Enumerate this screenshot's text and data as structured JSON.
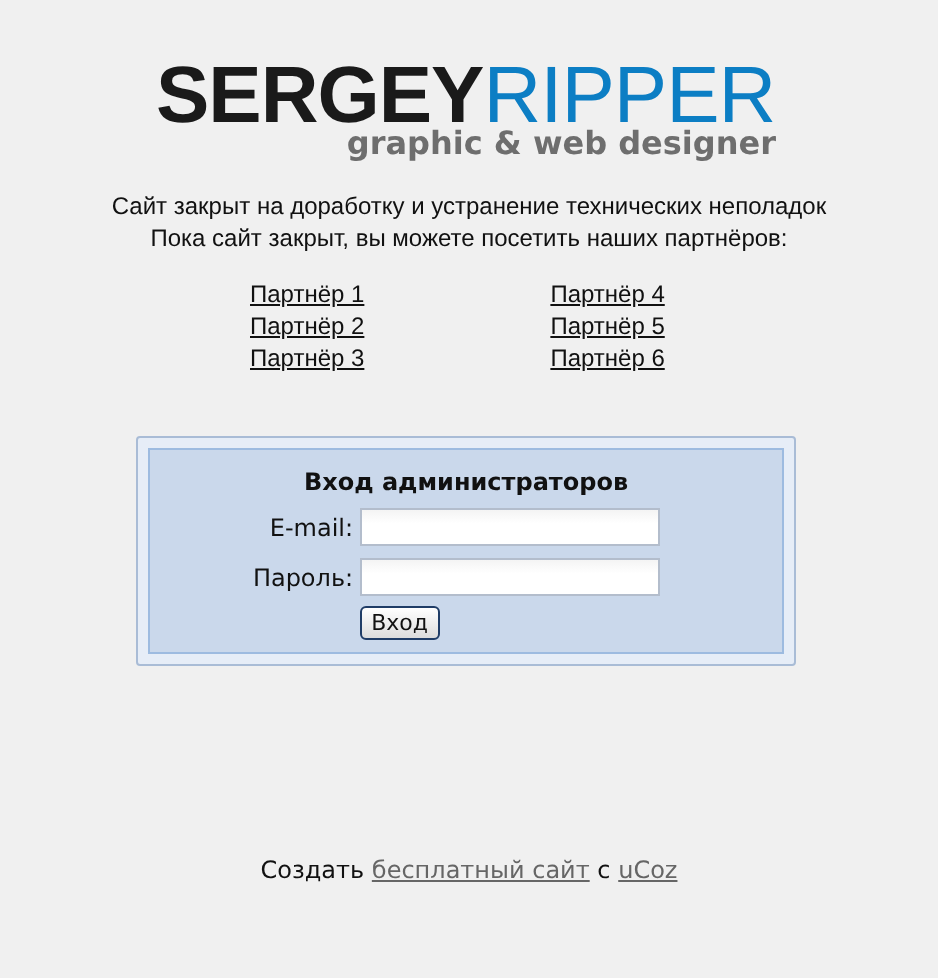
{
  "logo": {
    "name_dark": "SERGEY",
    "name_accent": "RIPPER",
    "tagline": "graphic & web designer"
  },
  "notice": [
    "Сайт закрыт на доработку и устранение технических неполадок",
    "Пока сайт закрыт, вы можете посетить наших партнёров:"
  ],
  "partners": [
    [
      "Партнёр 1",
      "Партнёр 2",
      "Партнёр 3"
    ],
    [
      "Партнёр 4",
      "Партнёр 5",
      "Партнёр 6"
    ]
  ],
  "login": {
    "title": "Вход администраторов",
    "fields": [
      {
        "label": "E-mail:"
      },
      {
        "label": "Пароль:"
      }
    ],
    "button": "Вход"
  },
  "footer": [
    {
      "kind": "text",
      "text": "Создать"
    },
    {
      "kind": "link",
      "text": "бесплатный сайт"
    },
    {
      "kind": "text",
      "text": "с"
    },
    {
      "kind": "link",
      "text": "uCoz"
    }
  ]
}
